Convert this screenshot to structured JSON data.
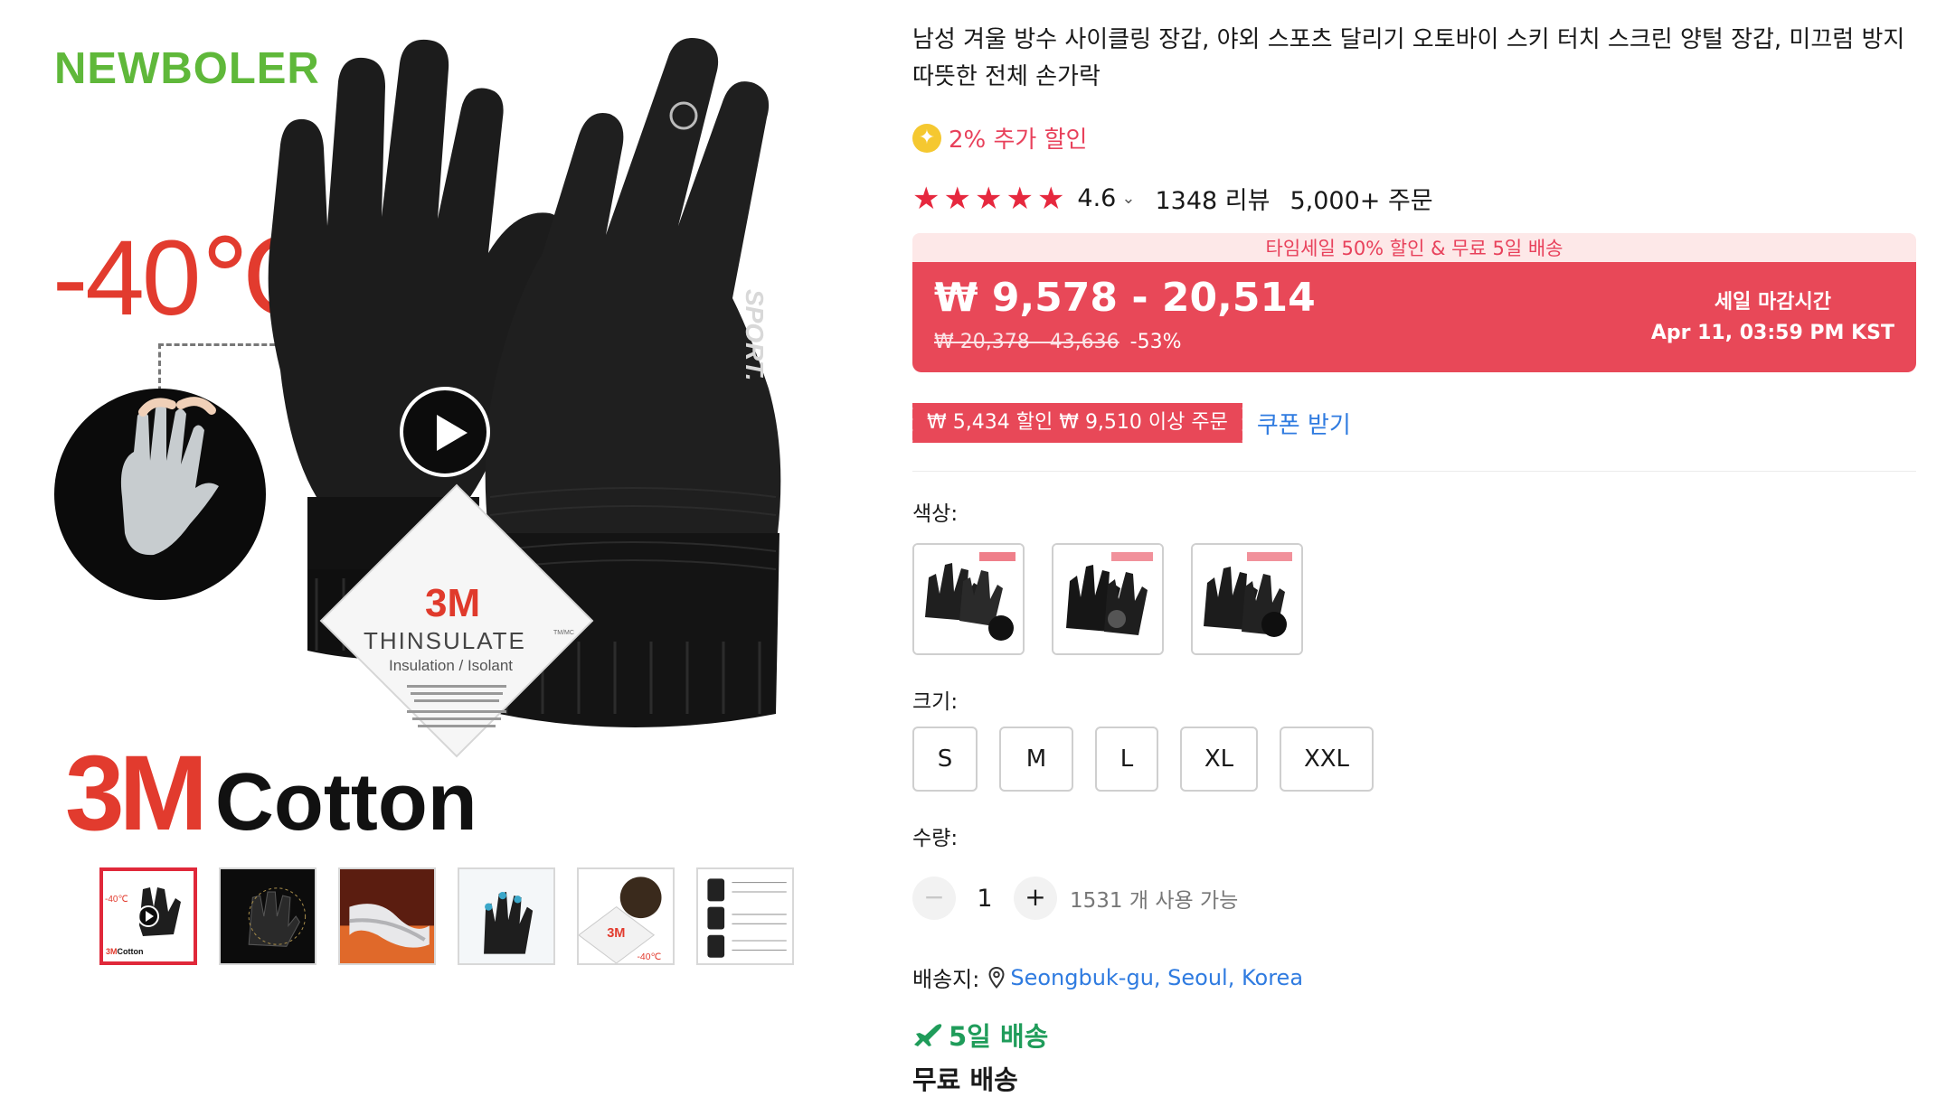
{
  "gallery": {
    "brand_logo": "NEWBOLER",
    "temperature": "-40℃",
    "caption_3m": "3M",
    "caption_cotton": "Cotton",
    "hangtag": {
      "brand": "3M",
      "product": "THINSULATE",
      "tm": "TM/MC",
      "subtitle": "Insulation / Isolant"
    },
    "glove_print": "SPORT.",
    "thumb_caption_3m": "3M",
    "thumb_caption_cotton": "Cotton",
    "thumb_temp": "-40℃",
    "thumbnail_count": 6
  },
  "product": {
    "title": "남성 겨울 방수 사이클링 장갑, 야외 스포츠 달리기 오토바이 스키 터치 스크린 양털 장갑, 미끄럼 방지 따뜻한 전체 손가락",
    "extra_discount": "2% 추가 할인",
    "rating": "4.6",
    "stars": 5,
    "reviews": "1348 리뷰",
    "orders": "5,000+ 주문"
  },
  "promo": {
    "banner": "타임세일 50% 할인 & 무료 5일 배송",
    "price": "₩ 9,578 - 20,514",
    "original_price": "₩ 20,378 - 43,636",
    "discount": "-53%",
    "deadline_label": "세일 마감시간",
    "deadline_time": "Apr 11, 03:59 PM KST"
  },
  "coupon": {
    "badge": "₩ 5,434 할인 ₩ 9,510 이상 주문",
    "link": "쿠폰 받기"
  },
  "color": {
    "label": "색상:"
  },
  "size": {
    "label": "크기:",
    "options": [
      "S",
      "M",
      "L",
      "XL",
      "XXL"
    ]
  },
  "quantity": {
    "label": "수량:",
    "minus": "−",
    "value": "1",
    "plus": "+",
    "available": "1531 개 사용 가능"
  },
  "shipping": {
    "label": "배송지:",
    "address": "Seongbuk-gu, Seoul, Korea",
    "delivery_time": "5일 배송",
    "free_label": "무료 배송"
  },
  "colors": {
    "accent_red": "#e84858",
    "link_blue": "#2f7be0",
    "delivery_green": "#1f9c5a",
    "star_red": "#e6283e",
    "logo_green": "#5fb83a"
  }
}
